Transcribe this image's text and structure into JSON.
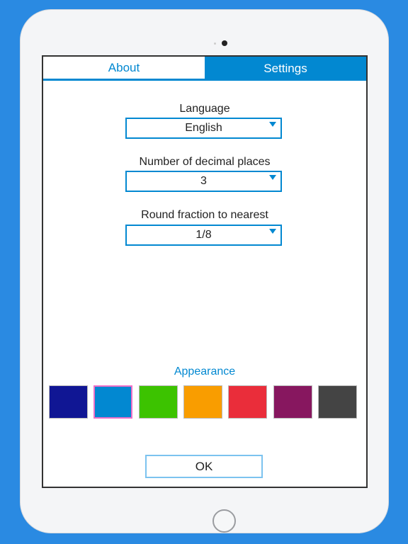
{
  "tabs": [
    {
      "label": "About",
      "active": false
    },
    {
      "label": "Settings",
      "active": true
    }
  ],
  "settings": {
    "language": {
      "label": "Language",
      "value": "English"
    },
    "decimal_places": {
      "label": "Number of decimal places",
      "value": "3"
    },
    "round_fraction": {
      "label": "Round fraction to nearest",
      "value": "1/8"
    }
  },
  "appearance": {
    "label": "Appearance",
    "selected_index": 1,
    "colors": [
      "#101694",
      "#0288d1",
      "#3cc300",
      "#f99d00",
      "#ea2d3a",
      "#87175f",
      "#444444"
    ]
  },
  "ok_label": "OK",
  "accent_color": "#0288d1"
}
